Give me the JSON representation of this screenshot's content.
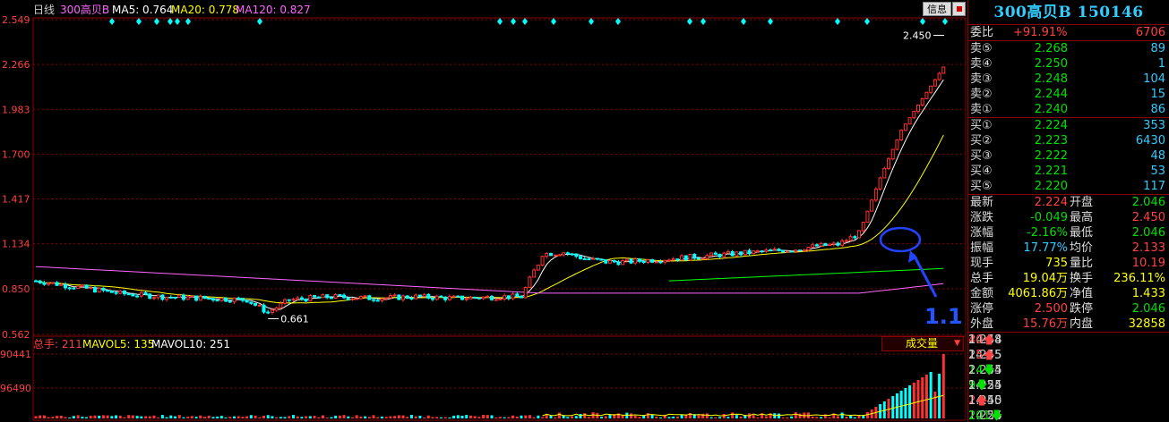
{
  "header": {
    "period": "日线",
    "stock": "300高贝B",
    "ma5": "MA5: 0.764",
    "ma20": "MA20: 0.778",
    "ma120": "MA120: 0.827",
    "info_button": "信息",
    "vol_label": "总手: 211",
    "mavol5": "MAVOL5: 135",
    "mavol10": "MAVOL10: 251",
    "vol_select": "成交量"
  },
  "colors": {
    "up": "#ff3030",
    "down": "#00ffff",
    "ma5": "#ffffff",
    "ma20": "#ffff00",
    "ma120": "#ff66ff",
    "ma_green": "#00ff00",
    "axis": "#8b0000"
  },
  "chart_data": {
    "type": "candlestick",
    "y_ticks": [
      "2.549",
      "2.266",
      "1.983",
      "1.700",
      "1.417",
      "1.134",
      "0.850",
      "0.562"
    ],
    "ylim": [
      0.562,
      2.549
    ],
    "vol_ticks": [
      "90441",
      "96490"
    ],
    "annotations": {
      "low": "0.661",
      "high": "2.450",
      "handwritten": "1.1"
    },
    "price_shape": [
      [
        0,
        0.9
      ],
      [
        10,
        0.86
      ],
      [
        20,
        0.82
      ],
      [
        30,
        0.8
      ],
      [
        40,
        0.79
      ],
      [
        50,
        0.78
      ],
      [
        55,
        0.7
      ],
      [
        60,
        0.78
      ],
      [
        70,
        0.8
      ],
      [
        80,
        0.79
      ],
      [
        90,
        0.8
      ],
      [
        100,
        0.79
      ],
      [
        110,
        0.8
      ],
      [
        115,
        0.8
      ],
      [
        120,
        1.07
      ],
      [
        125,
        1.08
      ],
      [
        130,
        1.04
      ],
      [
        135,
        1.02
      ],
      [
        140,
        1.02
      ],
      [
        150,
        1.04
      ],
      [
        160,
        1.06
      ],
      [
        170,
        1.08
      ],
      [
        180,
        1.1
      ],
      [
        185,
        1.12
      ],
      [
        190,
        1.13
      ],
      [
        195,
        1.2
      ],
      [
        200,
        1.55
      ],
      [
        205,
        1.85
      ],
      [
        210,
        2.05
      ],
      [
        215,
        2.25
      ]
    ]
  },
  "sidebar": {
    "title": "300高贝B 150146",
    "weibi": {
      "label": "委比",
      "value": "+91.91%",
      "count": "6706"
    },
    "asks": [
      {
        "label": "卖⑤",
        "price": "2.268",
        "vol": "89"
      },
      {
        "label": "卖④",
        "price": "2.250",
        "vol": "1"
      },
      {
        "label": "卖③",
        "price": "2.248",
        "vol": "104"
      },
      {
        "label": "卖②",
        "price": "2.244",
        "vol": "15"
      },
      {
        "label": "卖①",
        "price": "2.240",
        "vol": "86"
      }
    ],
    "bids": [
      {
        "label": "买①",
        "price": "2.224",
        "vol": "353"
      },
      {
        "label": "买②",
        "price": "2.223",
        "vol": "6430"
      },
      {
        "label": "买③",
        "price": "2.222",
        "vol": "48"
      },
      {
        "label": "买④",
        "price": "2.221",
        "vol": "53"
      },
      {
        "label": "买⑤",
        "price": "2.220",
        "vol": "117"
      }
    ],
    "stats": [
      {
        "l1": "最新",
        "v1": "2.224",
        "c1": "r",
        "l2": "开盘",
        "v2": "2.046",
        "c2": "g"
      },
      {
        "l1": "涨跌",
        "v1": "-0.049",
        "c1": "g",
        "l2": "最高",
        "v2": "2.450",
        "c2": "r"
      },
      {
        "l1": "涨幅",
        "v1": "-2.16%",
        "c1": "g",
        "l2": "最低",
        "v2": "2.046",
        "c2": "g"
      },
      {
        "l1": "振幅",
        "v1": "17.77%",
        "c1": "c",
        "l2": "均价",
        "v2": "2.133",
        "c2": "r"
      },
      {
        "l1": "现手",
        "v1": "735",
        "c1": "y",
        "l2": "量比",
        "v2": "10.19",
        "c2": "r"
      },
      {
        "l1": "总手",
        "v1": "19.04万",
        "c1": "y",
        "l2": "换手",
        "v2": "236.11%",
        "c2": "y"
      },
      {
        "l1": "金额",
        "v1": "4061.86万",
        "c1": "y",
        "l2": "净值",
        "v2": "1.433",
        "c2": "y"
      },
      {
        "l1": "涨停",
        "v1": "2.500",
        "c1": "r",
        "l2": "跌停",
        "v2": "2.046",
        "c2": "g"
      },
      {
        "l1": "外盘",
        "v1": "15.76万",
        "c1": "r",
        "l2": "内盘",
        "v2": "32858",
        "c2": "y"
      }
    ],
    "ticks": [
      {
        "time": "14:54",
        "price": "2.248",
        "qty": "40",
        "dir": "up",
        "num": "1"
      },
      {
        "time": "14:55",
        "price": "2.245",
        "qty": "15",
        "dir": "up",
        "num": "1"
      },
      {
        "time": "14:55",
        "price": "2.244",
        "qty": "14",
        "dir": "down",
        "num": "2"
      },
      {
        "time": "14:55",
        "price": "2.224",
        "qty": "9",
        "dir": "down",
        "num": "1"
      },
      {
        "time": "14:55",
        "price": "2.240",
        "qty": "2",
        "dir": "up",
        "num": "1"
      },
      {
        "time": "14:56",
        "price": "2.224",
        "qty": "201",
        "dir": "down",
        "num": ""
      }
    ]
  }
}
